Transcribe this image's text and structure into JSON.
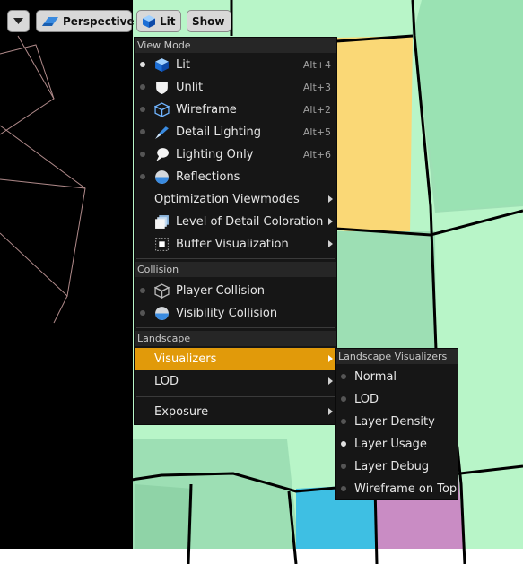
{
  "toolbar": {
    "dropdown_icon": "chevron-down-icon",
    "perspective_label": "Perspective",
    "perspective_icon": "perspective-icon",
    "lit_label": "Lit",
    "lit_icon": "lit-cube-icon",
    "show_label": "Show"
  },
  "view_menu": {
    "view_mode_header": "View Mode",
    "view_modes": [
      {
        "label": "Lit",
        "shortcut": "Alt+4",
        "icon": "lit-cube-icon",
        "selected": true
      },
      {
        "label": "Unlit",
        "shortcut": "Alt+3",
        "icon": "unlit-shield-icon",
        "selected": false
      },
      {
        "label": "Wireframe",
        "shortcut": "Alt+2",
        "icon": "wireframe-cube-icon",
        "selected": false
      },
      {
        "label": "Detail Lighting",
        "shortcut": "Alt+5",
        "icon": "detail-lighting-icon",
        "selected": false
      },
      {
        "label": "Lighting Only",
        "shortcut": "Alt+6",
        "icon": "lighting-only-icon",
        "selected": false
      },
      {
        "label": "Reflections",
        "shortcut": "",
        "icon": "reflections-sphere-icon",
        "selected": false
      }
    ],
    "optimization_viewmodes": "Optimization Viewmodes",
    "level_of_detail_coloration": "Level of Detail Coloration",
    "buffer_visualization": "Buffer Visualization",
    "collision_header": "Collision",
    "player_collision": "Player Collision",
    "visibility_collision": "Visibility Collision",
    "landscape_header": "Landscape",
    "visualizers": "Visualizers",
    "lod": "LOD",
    "exposure": "Exposure"
  },
  "landscape_submenu": {
    "header": "Landscape Visualizers",
    "items": [
      {
        "label": "Normal",
        "selected": false
      },
      {
        "label": "LOD",
        "selected": false
      },
      {
        "label": "Layer Density",
        "selected": false
      },
      {
        "label": "Layer Usage",
        "selected": true
      },
      {
        "label": "Layer Debug",
        "selected": false
      },
      {
        "label": "Wireframe on Top",
        "selected": false
      }
    ]
  },
  "colors": {
    "menu_background": "#161616",
    "highlight": "#e19a0a",
    "landscape_green": "#b8f5c8",
    "landscape_yellow": "#fad876",
    "landscape_cyan": "#3ebfe3",
    "landscape_pink": "#c98cc4"
  }
}
